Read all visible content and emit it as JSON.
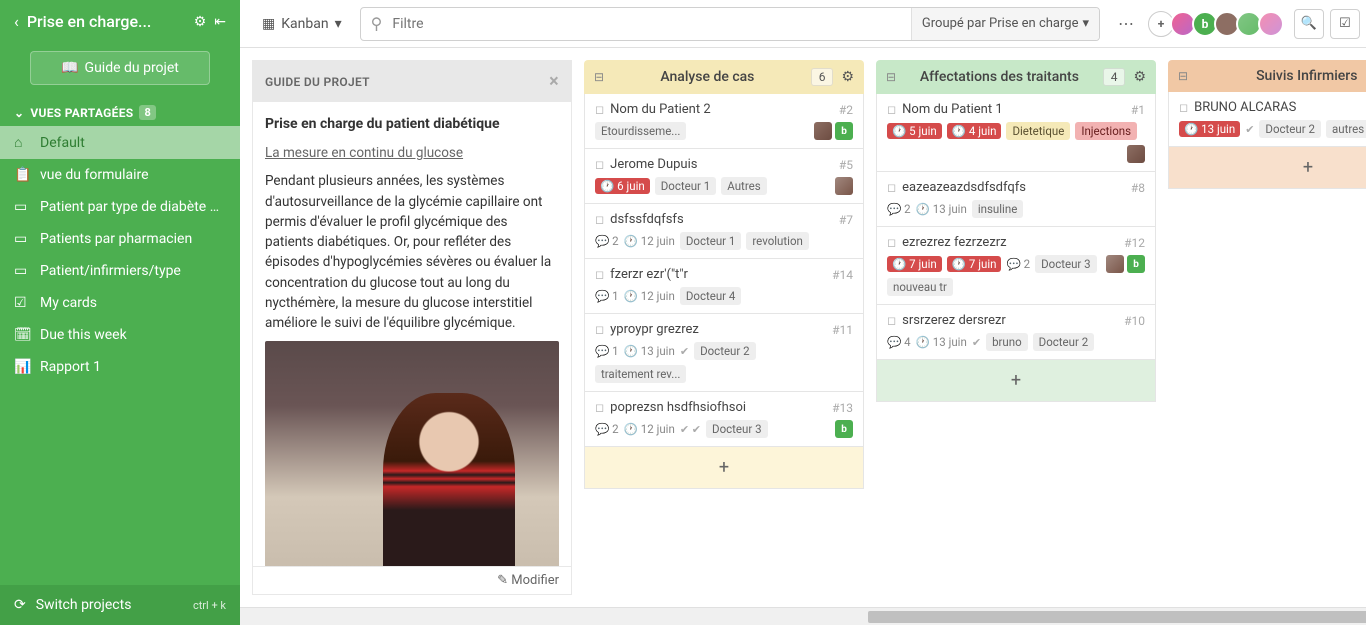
{
  "sidebar": {
    "projectTitle": "Prise en charge...",
    "guideButton": "Guide du projet",
    "sectionTitle": "VUES PARTAGÉES",
    "sectionCount": "8",
    "items": [
      {
        "icon": "home",
        "label": "Default"
      },
      {
        "icon": "clipboard",
        "label": "vue du formulaire"
      },
      {
        "icon": "book",
        "label": "Patient par type de diabète p..."
      },
      {
        "icon": "book",
        "label": "Patients par pharmacien"
      },
      {
        "icon": "book",
        "label": "Patient/infirmiers/type"
      },
      {
        "icon": "check",
        "label": "My cards"
      },
      {
        "icon": "calendar",
        "label": "Due this week"
      },
      {
        "icon": "chart",
        "label": "Rapport 1"
      }
    ],
    "switchProjects": "Switch projects",
    "switchKbd": "ctrl + k"
  },
  "topbar": {
    "viewType": "Kanban",
    "filterPlaceholder": "Filtre",
    "groupBy": "Groupé par Prise en charge"
  },
  "guide": {
    "headerLabel": "GUIDE DU PROJET",
    "title": "Prise en charge du patient diabétique",
    "subtitle": "La mesure en continu du glucose",
    "body": "Pendant plusieurs années, les systèmes d'autosurveillance de la glycémie capillaire ont permis d'évaluer le profil glycémique des patients diabétiques. Or, pour refléter des épisodes d'hypoglycémies sévères ou évaluer la concentration du glucose tout au long du nycthémère, la mesure du glucose interstitiel améliore le suivi de l'équilibre glycémique.",
    "footer": "Modifier"
  },
  "columns": [
    {
      "color": "yellow",
      "title": "Analyse de cas",
      "count": "6",
      "cards": [
        {
          "title": "Nom du Patient 2",
          "num": "#2",
          "tags": [
            "Etourdisseme..."
          ],
          "avatars": [
            "u1",
            "u2"
          ]
        },
        {
          "title": "Jerome Dupuis",
          "num": "#5",
          "dateBadge": "6 juin",
          "metaTags": [
            "Docteur 1",
            "Autres"
          ],
          "avatars": [
            "u3"
          ]
        },
        {
          "title": "dsfssfdqfsfs",
          "num": "#7",
          "comments": "2",
          "date": "12 juin",
          "metaTags": [
            "Docteur 1",
            "revolution"
          ]
        },
        {
          "title": "fzerzr ezr'(\"t\"r",
          "num": "#14",
          "comments": "1",
          "date": "12 juin",
          "metaTags": [
            "Docteur 4"
          ]
        },
        {
          "title": "yproypr grezrez",
          "num": "#11",
          "comments": "1",
          "date": "13 juin",
          "check": true,
          "metaTags": [
            "Docteur 2"
          ],
          "extraTags": [
            "traitement rev..."
          ]
        },
        {
          "title": "poprezsn hsdfhsiofhsoi",
          "num": "#13",
          "comments": "2",
          "date": "12 juin",
          "doubleCheck": true,
          "metaTags": [
            "Docteur 3"
          ],
          "avatars": [
            "u2"
          ]
        }
      ]
    },
    {
      "color": "green",
      "title": "Affectations des traitants",
      "count": "4",
      "cards": [
        {
          "title": "Nom du Patient 1",
          "num": "#1",
          "dateBadges": [
            "5 juin",
            "4 juin"
          ],
          "coloredTags": [
            {
              "label": "Dietetique",
              "c": "yellow"
            },
            {
              "label": "Injections",
              "c": "pink"
            }
          ],
          "avatars": [
            "u1"
          ]
        },
        {
          "title": "eazeazeazdsdfsdfqfs",
          "num": "#8",
          "comments": "2",
          "date": "13 juin",
          "metaTags": [
            "insuline"
          ]
        },
        {
          "title": "ezrezrez fezrzezrz",
          "num": "#12",
          "comments": "2",
          "dateBadges": [
            "7 juin",
            "7 juin"
          ],
          "metaTags": [
            "Docteur 3"
          ],
          "extraTags": [
            "nouveau tr"
          ],
          "avatars": [
            "u3",
            "u2"
          ]
        },
        {
          "title": "srsrzerez dersrezr",
          "num": "#10",
          "comments": "4",
          "date": "13 juin",
          "check": true,
          "metaTags": [
            "bruno",
            "Docteur 2"
          ]
        }
      ]
    },
    {
      "color": "orange",
      "title": "Suivis Infirmiers",
      "count": "",
      "cards": [
        {
          "title": "BRUNO ALCARAS",
          "num": "",
          "dateBadge": "13 juin",
          "check": true,
          "metaTags": [
            "Docteur 2",
            "autres"
          ]
        }
      ]
    }
  ]
}
